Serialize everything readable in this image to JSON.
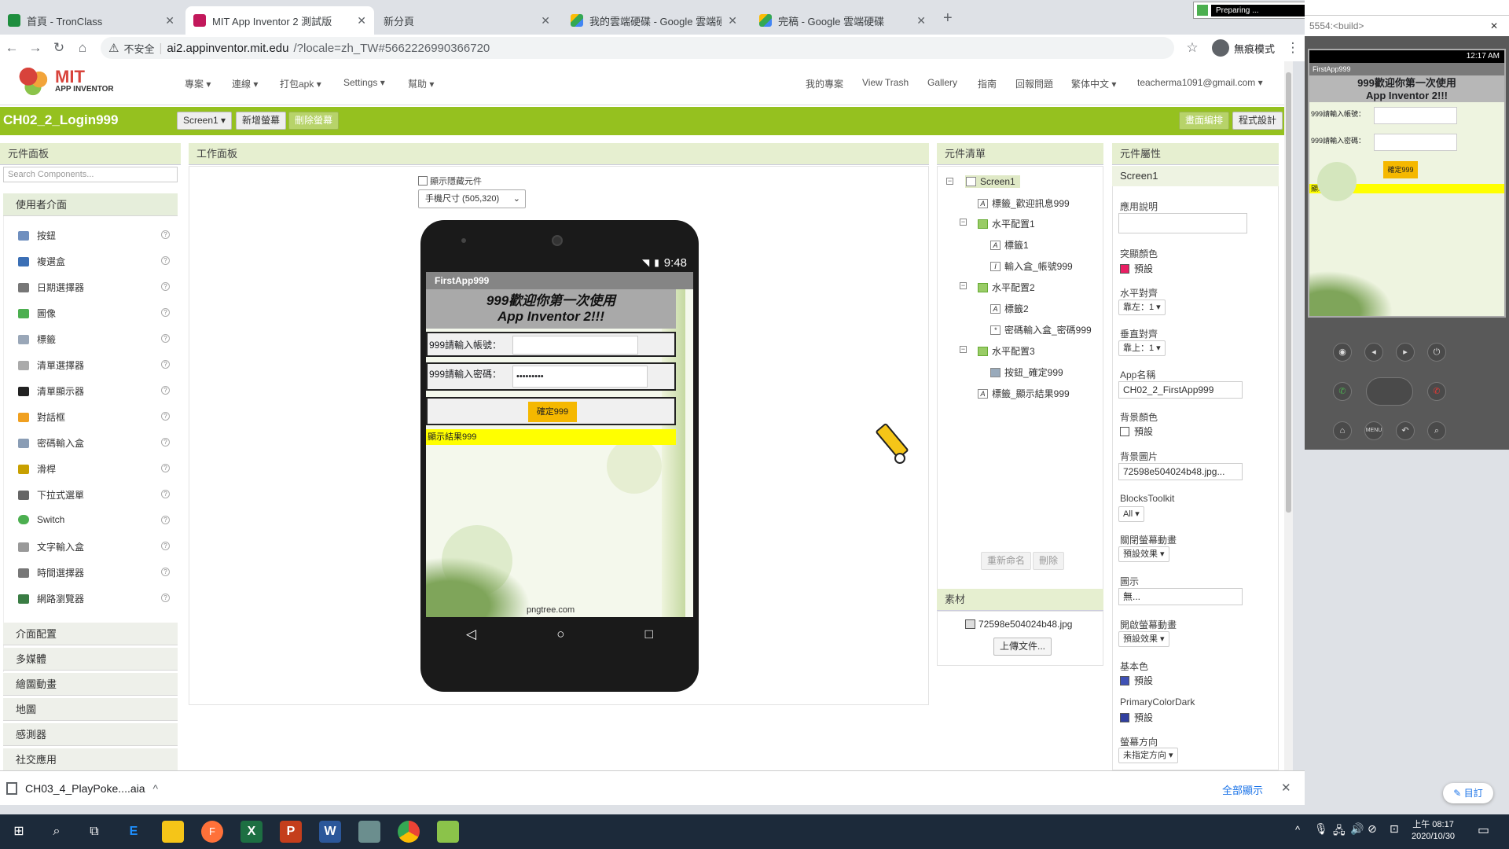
{
  "browser": {
    "tabs": [
      {
        "title": "首頁 - TronClass",
        "color": "#1e8e3e"
      },
      {
        "title": "MIT App Inventor 2 測試版",
        "color": "#c2185b"
      },
      {
        "title": "新分頁",
        "color": "#ffffff"
      },
      {
        "title": "我的雲端硬碟 - Google 雲端硬碟",
        "color": "#34a853"
      },
      {
        "title": "完稿 - Google 雲端硬碟",
        "color": "#34a853"
      }
    ],
    "new_tab": "+",
    "security_label": "不安全",
    "url_domain": "ai2.appinventor.mit.edu",
    "url_path": "/?locale=zh_TW#5662226990366720",
    "incognito_label": "無痕模式",
    "preparing_label": "Preparing ..."
  },
  "app": {
    "logo_title": "MIT",
    "logo_sub": "APP INVENTOR",
    "menu_left": [
      "專案",
      "連線",
      "打包apk",
      "Settings",
      "幫助"
    ],
    "menu_right": [
      "我的專案",
      "View Trash",
      "Gallery",
      "指南",
      "回報問題",
      "繁体中文",
      "teacherma1091@gmail.com"
    ],
    "project_name": "CH02_2_Login999",
    "screen_selector": "Screen1",
    "add_screen": "新增螢幕",
    "remove_screen": "刪除螢幕",
    "designer_btn": "畫面編排",
    "blocks_btn": "程式設計"
  },
  "palette": {
    "header": "元件面板",
    "search_placeholder": "Search Components...",
    "category_open": "使用者介面",
    "items": [
      {
        "label": "按鈕",
        "color": "#6f8fbf"
      },
      {
        "label": "複選盒",
        "color": "#3b6fb5"
      },
      {
        "label": "日期選擇器",
        "color": "#777777"
      },
      {
        "label": "圖像",
        "color": "#4caf50"
      },
      {
        "label": "標籤",
        "color": "#9aa7b8"
      },
      {
        "label": "清單選擇器",
        "color": "#aaaaaa"
      },
      {
        "label": "清單顯示器",
        "color": "#222222"
      },
      {
        "label": "對話框",
        "color": "#f0a020"
      },
      {
        "label": "密碼輸入盒",
        "color": "#8a9db5"
      },
      {
        "label": "滑桿",
        "color": "#c8a000"
      },
      {
        "label": "下拉式選單",
        "color": "#666666"
      },
      {
        "label": "Switch",
        "color": "#4caf50"
      },
      {
        "label": "文字輸入盒",
        "color": "#999999"
      },
      {
        "label": "時間選擇器",
        "color": "#777777"
      },
      {
        "label": "網路瀏覽器",
        "color": "#3a7d44"
      }
    ],
    "help_glyph": "?",
    "categories": [
      "介面配置",
      "多媒體",
      "繪圖動畫",
      "地圖",
      "感測器",
      "社交應用"
    ]
  },
  "viewer": {
    "header": "工作面板",
    "hidden_checkbox_label": "顯示隱藏元件",
    "size_select": "手機尺寸 (505,320)",
    "status_time": "9:48",
    "app_title": "FirstApp999",
    "welcome_line1": "999歡迎你第一次使用",
    "welcome_line2": "App Inventor 2!!!",
    "account_label": "999請輸入帳號：",
    "password_label": "999請輸入密碼：",
    "password_value": "•••••••••",
    "confirm_button": "確定999",
    "result_label": "顯示結果999",
    "watermark": "pngtree.com"
  },
  "components": {
    "header": "元件清單",
    "tree": [
      {
        "label": "Screen1",
        "icon": "screen-icon"
      },
      {
        "label": "標籤_歡迎訊息999",
        "icon": "label-icon"
      },
      {
        "label": "水平配置1",
        "icon": "layout-icon"
      },
      {
        "label": "標籤1",
        "icon": "label-icon"
      },
      {
        "label": "輸入盒_帳號999",
        "icon": "textbox-icon"
      },
      {
        "label": "水平配置2",
        "icon": "layout-icon"
      },
      {
        "label": "標籤2",
        "icon": "label-icon"
      },
      {
        "label": "密碼輸入盒_密碼999",
        "icon": "password-icon"
      },
      {
        "label": "水平配置3",
        "icon": "layout-icon"
      },
      {
        "label": "按鈕_確定999",
        "icon": "button-icon"
      },
      {
        "label": "標籤_顯示結果999",
        "icon": "label-icon"
      }
    ],
    "rename": "重新命名",
    "delete": "刪除",
    "media_header": "素材",
    "media_file": "72598e504024b48.jpg",
    "upload": "上傳文件..."
  },
  "properties": {
    "header": "元件屬性",
    "component": "Screen1",
    "about_label": "應用說明",
    "accent_label": "突顯顏色",
    "accent_value": "預設",
    "accent_color": "#e91e63",
    "align_h_label": "水平對齊",
    "align_h_value": "靠左：1",
    "align_v_label": "垂直對齊",
    "align_v_value": "靠上：1",
    "appname_label": "App名稱",
    "appname_value": "CH02_2_FirstApp999",
    "bgcolor_label": "背景顏色",
    "bgcolor_value": "預設",
    "bgimage_label": "背景圖片",
    "bgimage_value": "72598e504024b48.jpg...",
    "toolkit_label": "BlocksToolkit",
    "toolkit_value": "All",
    "close_anim_label": "關閉螢幕動畫",
    "close_anim_value": "預設效果",
    "icon_label": "圖示",
    "icon_value": "無...",
    "open_anim_label": "開啟螢幕動畫",
    "open_anim_value": "預設效果",
    "primary_label": "基本色",
    "primary_value": "預設",
    "primary_color": "#3f51b5",
    "primary_dark_label": "PrimaryColorDark",
    "primary_dark_value": "預設",
    "primary_dark_color": "#303f9f",
    "orientation_label": "螢幕方向",
    "orientation_value": "未指定方向"
  },
  "emulator": {
    "title": "5554:<build>",
    "time": "12:17 AM",
    "app_title": "FirstApp999",
    "welcome_line1": "999歡迎你第一次使用",
    "welcome_line2": "App Inventor 2!!!",
    "account_label": "999請輸入帳號：",
    "password_label": "999請輸入密碼：",
    "confirm": "確定999",
    "result": "顯示結果999",
    "menu_button": "MENU"
  },
  "download": {
    "file": "CH03_4_PlayPoke....aia",
    "show_all": "全部顯示",
    "close": "✕"
  },
  "annotate": {
    "label": "目訂"
  },
  "taskbar": {
    "time": "上午 08:17",
    "date": "2020/10/30",
    "apps": [
      "E",
      "F",
      "X",
      "P",
      "W"
    ]
  }
}
